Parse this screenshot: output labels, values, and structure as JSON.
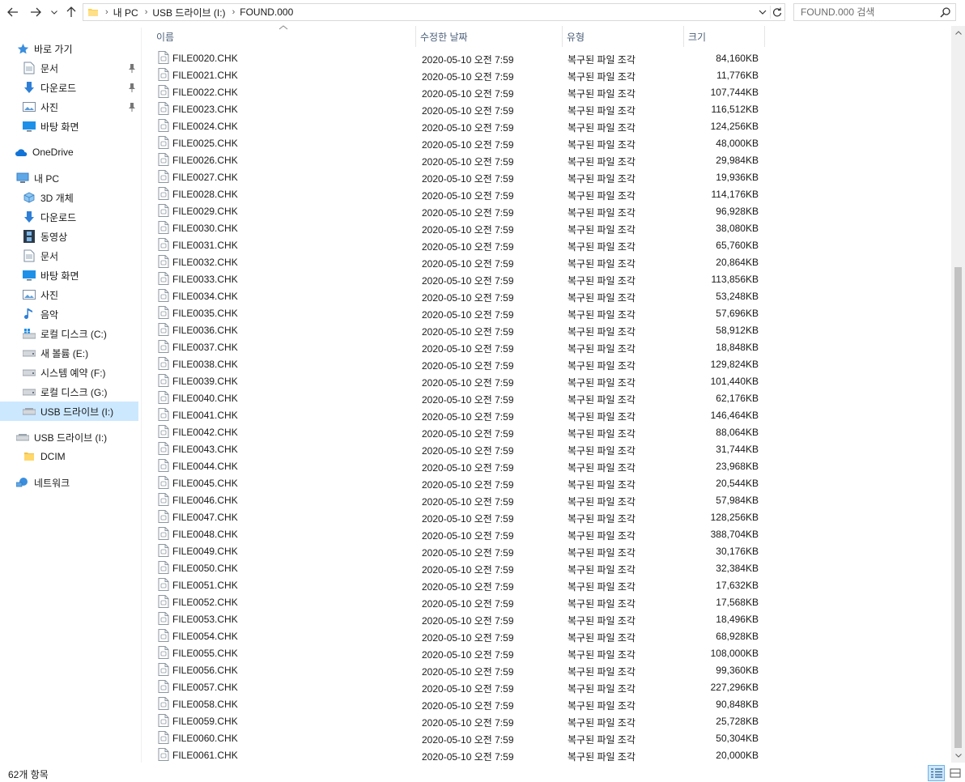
{
  "address": {
    "crumbs": [
      "내 PC",
      "USB 드라이브 (I:)",
      "FOUND.000"
    ]
  },
  "search": {
    "placeholder": "FOUND.000 검색"
  },
  "sidebar": {
    "items": [
      {
        "label": "바로 가기",
        "icon": "star-icon"
      },
      {
        "label": "문서",
        "icon": "document-icon",
        "pinned": true
      },
      {
        "label": "다운로드",
        "icon": "download-arrow-icon",
        "pinned": true
      },
      {
        "label": "사진",
        "icon": "picture-icon",
        "pinned": true
      },
      {
        "label": "바탕 화면",
        "icon": "desktop-icon"
      },
      {
        "label": "OneDrive",
        "icon": "cloud-icon"
      },
      {
        "label": "내 PC",
        "icon": "computer-icon"
      },
      {
        "label": "3D 개체",
        "icon": "cube-icon"
      },
      {
        "label": "다운로드",
        "icon": "download-arrow-icon"
      },
      {
        "label": "동영상",
        "icon": "film-icon"
      },
      {
        "label": "문서",
        "icon": "document-icon"
      },
      {
        "label": "바탕 화면",
        "icon": "desktop-icon"
      },
      {
        "label": "사진",
        "icon": "picture-icon"
      },
      {
        "label": "음악",
        "icon": "music-note-icon"
      },
      {
        "label": "로컬 디스크 (C:)",
        "icon": "windows-drive-icon"
      },
      {
        "label": "새 볼륨 (E:)",
        "icon": "drive-icon"
      },
      {
        "label": "시스템 예약 (F:)",
        "icon": "drive-icon"
      },
      {
        "label": "로컬 디스크 (G:)",
        "icon": "drive-icon"
      },
      {
        "label": "USB 드라이브 (I:)",
        "icon": "usb-drive-icon",
        "selected": true
      },
      {
        "label": "USB 드라이브 (I:)",
        "icon": "usb-drive-icon"
      },
      {
        "label": "DCIM",
        "icon": "folder-icon"
      },
      {
        "label": "네트워크",
        "icon": "network-icon"
      }
    ]
  },
  "columns": {
    "name": "이름",
    "date": "수정한 날짜",
    "type": "유형",
    "size": "크기"
  },
  "files": [
    {
      "name": "FILE0020.CHK",
      "date": "2020-05-10 오전 7:59",
      "type": "복구된 파일 조각",
      "size": "84,160KB"
    },
    {
      "name": "FILE0021.CHK",
      "date": "2020-05-10 오전 7:59",
      "type": "복구된 파일 조각",
      "size": "11,776KB"
    },
    {
      "name": "FILE0022.CHK",
      "date": "2020-05-10 오전 7:59",
      "type": "복구된 파일 조각",
      "size": "107,744KB"
    },
    {
      "name": "FILE0023.CHK",
      "date": "2020-05-10 오전 7:59",
      "type": "복구된 파일 조각",
      "size": "116,512KB"
    },
    {
      "name": "FILE0024.CHK",
      "date": "2020-05-10 오전 7:59",
      "type": "복구된 파일 조각",
      "size": "124,256KB"
    },
    {
      "name": "FILE0025.CHK",
      "date": "2020-05-10 오전 7:59",
      "type": "복구된 파일 조각",
      "size": "48,000KB"
    },
    {
      "name": "FILE0026.CHK",
      "date": "2020-05-10 오전 7:59",
      "type": "복구된 파일 조각",
      "size": "29,984KB"
    },
    {
      "name": "FILE0027.CHK",
      "date": "2020-05-10 오전 7:59",
      "type": "복구된 파일 조각",
      "size": "19,936KB"
    },
    {
      "name": "FILE0028.CHK",
      "date": "2020-05-10 오전 7:59",
      "type": "복구된 파일 조각",
      "size": "114,176KB"
    },
    {
      "name": "FILE0029.CHK",
      "date": "2020-05-10 오전 7:59",
      "type": "복구된 파일 조각",
      "size": "96,928KB"
    },
    {
      "name": "FILE0030.CHK",
      "date": "2020-05-10 오전 7:59",
      "type": "복구된 파일 조각",
      "size": "38,080KB"
    },
    {
      "name": "FILE0031.CHK",
      "date": "2020-05-10 오전 7:59",
      "type": "복구된 파일 조각",
      "size": "65,760KB"
    },
    {
      "name": "FILE0032.CHK",
      "date": "2020-05-10 오전 7:59",
      "type": "복구된 파일 조각",
      "size": "20,864KB"
    },
    {
      "name": "FILE0033.CHK",
      "date": "2020-05-10 오전 7:59",
      "type": "복구된 파일 조각",
      "size": "113,856KB"
    },
    {
      "name": "FILE0034.CHK",
      "date": "2020-05-10 오전 7:59",
      "type": "복구된 파일 조각",
      "size": "53,248KB"
    },
    {
      "name": "FILE0035.CHK",
      "date": "2020-05-10 오전 7:59",
      "type": "복구된 파일 조각",
      "size": "57,696KB"
    },
    {
      "name": "FILE0036.CHK",
      "date": "2020-05-10 오전 7:59",
      "type": "복구된 파일 조각",
      "size": "58,912KB"
    },
    {
      "name": "FILE0037.CHK",
      "date": "2020-05-10 오전 7:59",
      "type": "복구된 파일 조각",
      "size": "18,848KB"
    },
    {
      "name": "FILE0038.CHK",
      "date": "2020-05-10 오전 7:59",
      "type": "복구된 파일 조각",
      "size": "129,824KB"
    },
    {
      "name": "FILE0039.CHK",
      "date": "2020-05-10 오전 7:59",
      "type": "복구된 파일 조각",
      "size": "101,440KB"
    },
    {
      "name": "FILE0040.CHK",
      "date": "2020-05-10 오전 7:59",
      "type": "복구된 파일 조각",
      "size": "62,176KB"
    },
    {
      "name": "FILE0041.CHK",
      "date": "2020-05-10 오전 7:59",
      "type": "복구된 파일 조각",
      "size": "146,464KB"
    },
    {
      "name": "FILE0042.CHK",
      "date": "2020-05-10 오전 7:59",
      "type": "복구된 파일 조각",
      "size": "88,064KB"
    },
    {
      "name": "FILE0043.CHK",
      "date": "2020-05-10 오전 7:59",
      "type": "복구된 파일 조각",
      "size": "31,744KB"
    },
    {
      "name": "FILE0044.CHK",
      "date": "2020-05-10 오전 7:59",
      "type": "복구된 파일 조각",
      "size": "23,968KB"
    },
    {
      "name": "FILE0045.CHK",
      "date": "2020-05-10 오전 7:59",
      "type": "복구된 파일 조각",
      "size": "20,544KB"
    },
    {
      "name": "FILE0046.CHK",
      "date": "2020-05-10 오전 7:59",
      "type": "복구된 파일 조각",
      "size": "57,984KB"
    },
    {
      "name": "FILE0047.CHK",
      "date": "2020-05-10 오전 7:59",
      "type": "복구된 파일 조각",
      "size": "128,256KB"
    },
    {
      "name": "FILE0048.CHK",
      "date": "2020-05-10 오전 7:59",
      "type": "복구된 파일 조각",
      "size": "388,704KB"
    },
    {
      "name": "FILE0049.CHK",
      "date": "2020-05-10 오전 7:59",
      "type": "복구된 파일 조각",
      "size": "30,176KB"
    },
    {
      "name": "FILE0050.CHK",
      "date": "2020-05-10 오전 7:59",
      "type": "복구된 파일 조각",
      "size": "32,384KB"
    },
    {
      "name": "FILE0051.CHK",
      "date": "2020-05-10 오전 7:59",
      "type": "복구된 파일 조각",
      "size": "17,632KB"
    },
    {
      "name": "FILE0052.CHK",
      "date": "2020-05-10 오전 7:59",
      "type": "복구된 파일 조각",
      "size": "17,568KB"
    },
    {
      "name": "FILE0053.CHK",
      "date": "2020-05-10 오전 7:59",
      "type": "복구된 파일 조각",
      "size": "18,496KB"
    },
    {
      "name": "FILE0054.CHK",
      "date": "2020-05-10 오전 7:59",
      "type": "복구된 파일 조각",
      "size": "68,928KB"
    },
    {
      "name": "FILE0055.CHK",
      "date": "2020-05-10 오전 7:59",
      "type": "복구된 파일 조각",
      "size": "108,000KB"
    },
    {
      "name": "FILE0056.CHK",
      "date": "2020-05-10 오전 7:59",
      "type": "복구된 파일 조각",
      "size": "99,360KB"
    },
    {
      "name": "FILE0057.CHK",
      "date": "2020-05-10 오전 7:59",
      "type": "복구된 파일 조각",
      "size": "227,296KB"
    },
    {
      "name": "FILE0058.CHK",
      "date": "2020-05-10 오전 7:59",
      "type": "복구된 파일 조각",
      "size": "90,848KB"
    },
    {
      "name": "FILE0059.CHK",
      "date": "2020-05-10 오전 7:59",
      "type": "복구된 파일 조각",
      "size": "25,728KB"
    },
    {
      "name": "FILE0060.CHK",
      "date": "2020-05-10 오전 7:59",
      "type": "복구된 파일 조각",
      "size": "50,304KB"
    },
    {
      "name": "FILE0061.CHK",
      "date": "2020-05-10 오전 7:59",
      "type": "복구된 파일 조각",
      "size": "20,000KB"
    }
  ],
  "status": {
    "count": "62개 항목"
  },
  "colors": {
    "selection": "#cce8ff",
    "header_text": "#4c607a",
    "accent": "#0078d7"
  }
}
